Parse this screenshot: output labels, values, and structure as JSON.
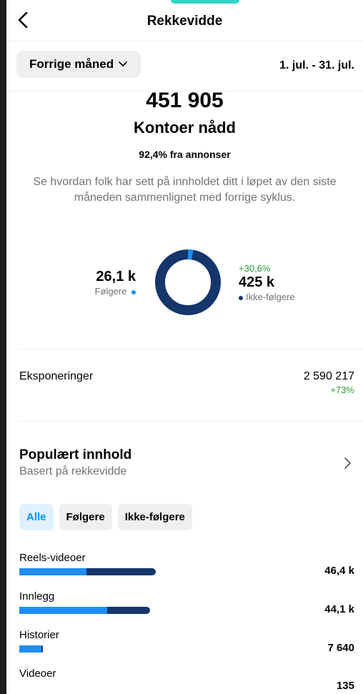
{
  "header": {
    "title": "Rekkevidde"
  },
  "period": {
    "selected": "Forrige måned",
    "date_range": "1. jul. - 31. jul."
  },
  "summary": {
    "accounts_reached": "451 905",
    "label": "Kontoer nådd",
    "from_ads": "92,4% fra annonser",
    "description": "Se hvordan folk har sett på innholdet ditt i løpet av den siste måneden sammenlignet med forrige syklus."
  },
  "audience": {
    "followers": {
      "value": "26,1 k",
      "label": "Følgere",
      "share": 0.058
    },
    "non_followers": {
      "change": "+30,6%",
      "value": "425 k",
      "label": "Ikke-følgere",
      "share": 0.942
    }
  },
  "impressions": {
    "label": "Eksponeringer",
    "value": "2 590 217",
    "change": "+73%"
  },
  "popular": {
    "title": "Populært innhold",
    "subtitle": "Basert på rekkevidde"
  },
  "filters": [
    "Alle",
    "Følgere",
    "Ikke-følgere"
  ],
  "content_types": [
    {
      "label": "Reels-videoer",
      "value": "46,4 k",
      "followers": 0.49,
      "non_followers": 0.51,
      "total": 1.0
    },
    {
      "label": "Innlegg",
      "value": "44,1 k",
      "followers": 0.67,
      "non_followers": 0.33,
      "total": 0.96
    },
    {
      "label": "Historier",
      "value": "7 640",
      "followers": 0.93,
      "non_followers": 0.07,
      "total": 0.175
    },
    {
      "label": "Videoer",
      "value": "135",
      "followers": 0,
      "non_followers": 0,
      "total": 0.0
    }
  ],
  "colors": {
    "followers": "#1d8ef5",
    "non_followers": "#14366b",
    "positive": "#2c9b3a",
    "accent": "#0095f6"
  }
}
